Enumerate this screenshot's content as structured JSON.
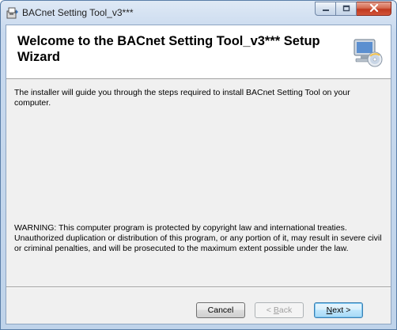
{
  "window": {
    "title": "BACnet Setting Tool_v3***",
    "icons": {
      "app": "installer-icon",
      "minimize": "minimize-icon",
      "maximize": "maximize-icon",
      "close": "close-icon"
    }
  },
  "banner": {
    "heading": "Welcome to the BACnet Setting Tool_v3*** Setup Wizard",
    "graphic": "setup-cd-computer-icon"
  },
  "body": {
    "description": "The installer will guide you through the steps required to install BACnet Setting Tool on your computer.",
    "warning": "WARNING: This computer program is protected by copyright law and international treaties. Unauthorized duplication or distribution of this program, or any portion of it, may result in severe civil or criminal penalties, and will be prosecuted to the maximum extent possible under the law."
  },
  "buttons": {
    "cancel": "Cancel",
    "back_prefix": "< ",
    "back_accel": "B",
    "back_rest": "ack",
    "next_accel": "N",
    "next_rest": "ext >"
  },
  "colors": {
    "close_button": "#c0391f",
    "default_button_border": "#3c7fb1"
  }
}
